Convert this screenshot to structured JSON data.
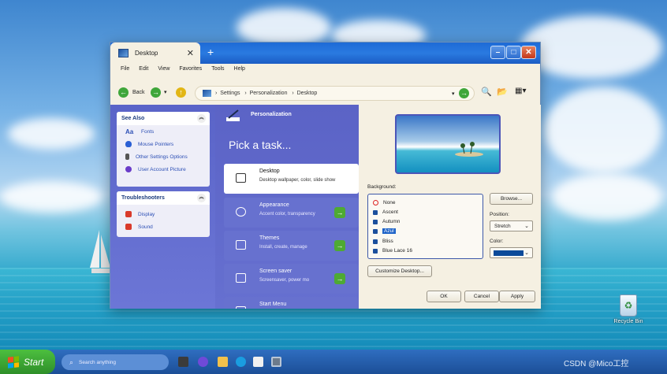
{
  "window": {
    "tab_title": "Desktop",
    "tab_close": "✕",
    "new_tab": "+",
    "min": "–",
    "max": "□",
    "close": "✕"
  },
  "menu": [
    "File",
    "Edit",
    "View",
    "Favorites",
    "Tools",
    "Help"
  ],
  "toolbar": {
    "back_label": "Back",
    "breadcrumb": [
      "Settings",
      "Personalization",
      "Desktop"
    ]
  },
  "see_also": {
    "title": "See Also",
    "items": [
      "Fonts",
      "Mouse Pointers",
      "Other Settings Options",
      "User Account Picture"
    ]
  },
  "troubleshooters": {
    "title": "Troubleshooters",
    "items": [
      "Display",
      "Sound"
    ]
  },
  "personalization": {
    "header": "Personalization",
    "pick_task": "Pick a task...",
    "tasks": [
      {
        "title": "Desktop",
        "subtitle": "Desktop wallpaper, color, slide show"
      },
      {
        "title": "Appearance",
        "subtitle": "Accent color, transparency"
      },
      {
        "title": "Themes",
        "subtitle": "Install, create, manage"
      },
      {
        "title": "Screen saver",
        "subtitle": "Screensaver, power mo"
      },
      {
        "title": "Start Menu",
        "subtitle": ""
      }
    ]
  },
  "desktop_settings": {
    "background_label": "Background:",
    "backgrounds": [
      "None",
      "Ascent",
      "Autumn",
      "Azul",
      "Bliss",
      "Blue Lace 16"
    ],
    "selected_background": "Azul",
    "browse_button": "Browse...",
    "position_label": "Position:",
    "position_value": "Stretch",
    "color_label": "Color:",
    "color_value": "#0b4a9a",
    "customize_button": "Customize Desktop...",
    "ok_button": "OK",
    "cancel_button": "Cancel",
    "apply_button": "Apply"
  },
  "desktop": {
    "recycle_bin": "Recycle Bin"
  },
  "taskbar": {
    "start": "Start",
    "search_placeholder": "Search anything",
    "tray_text": "CSDN @Mico工控"
  }
}
